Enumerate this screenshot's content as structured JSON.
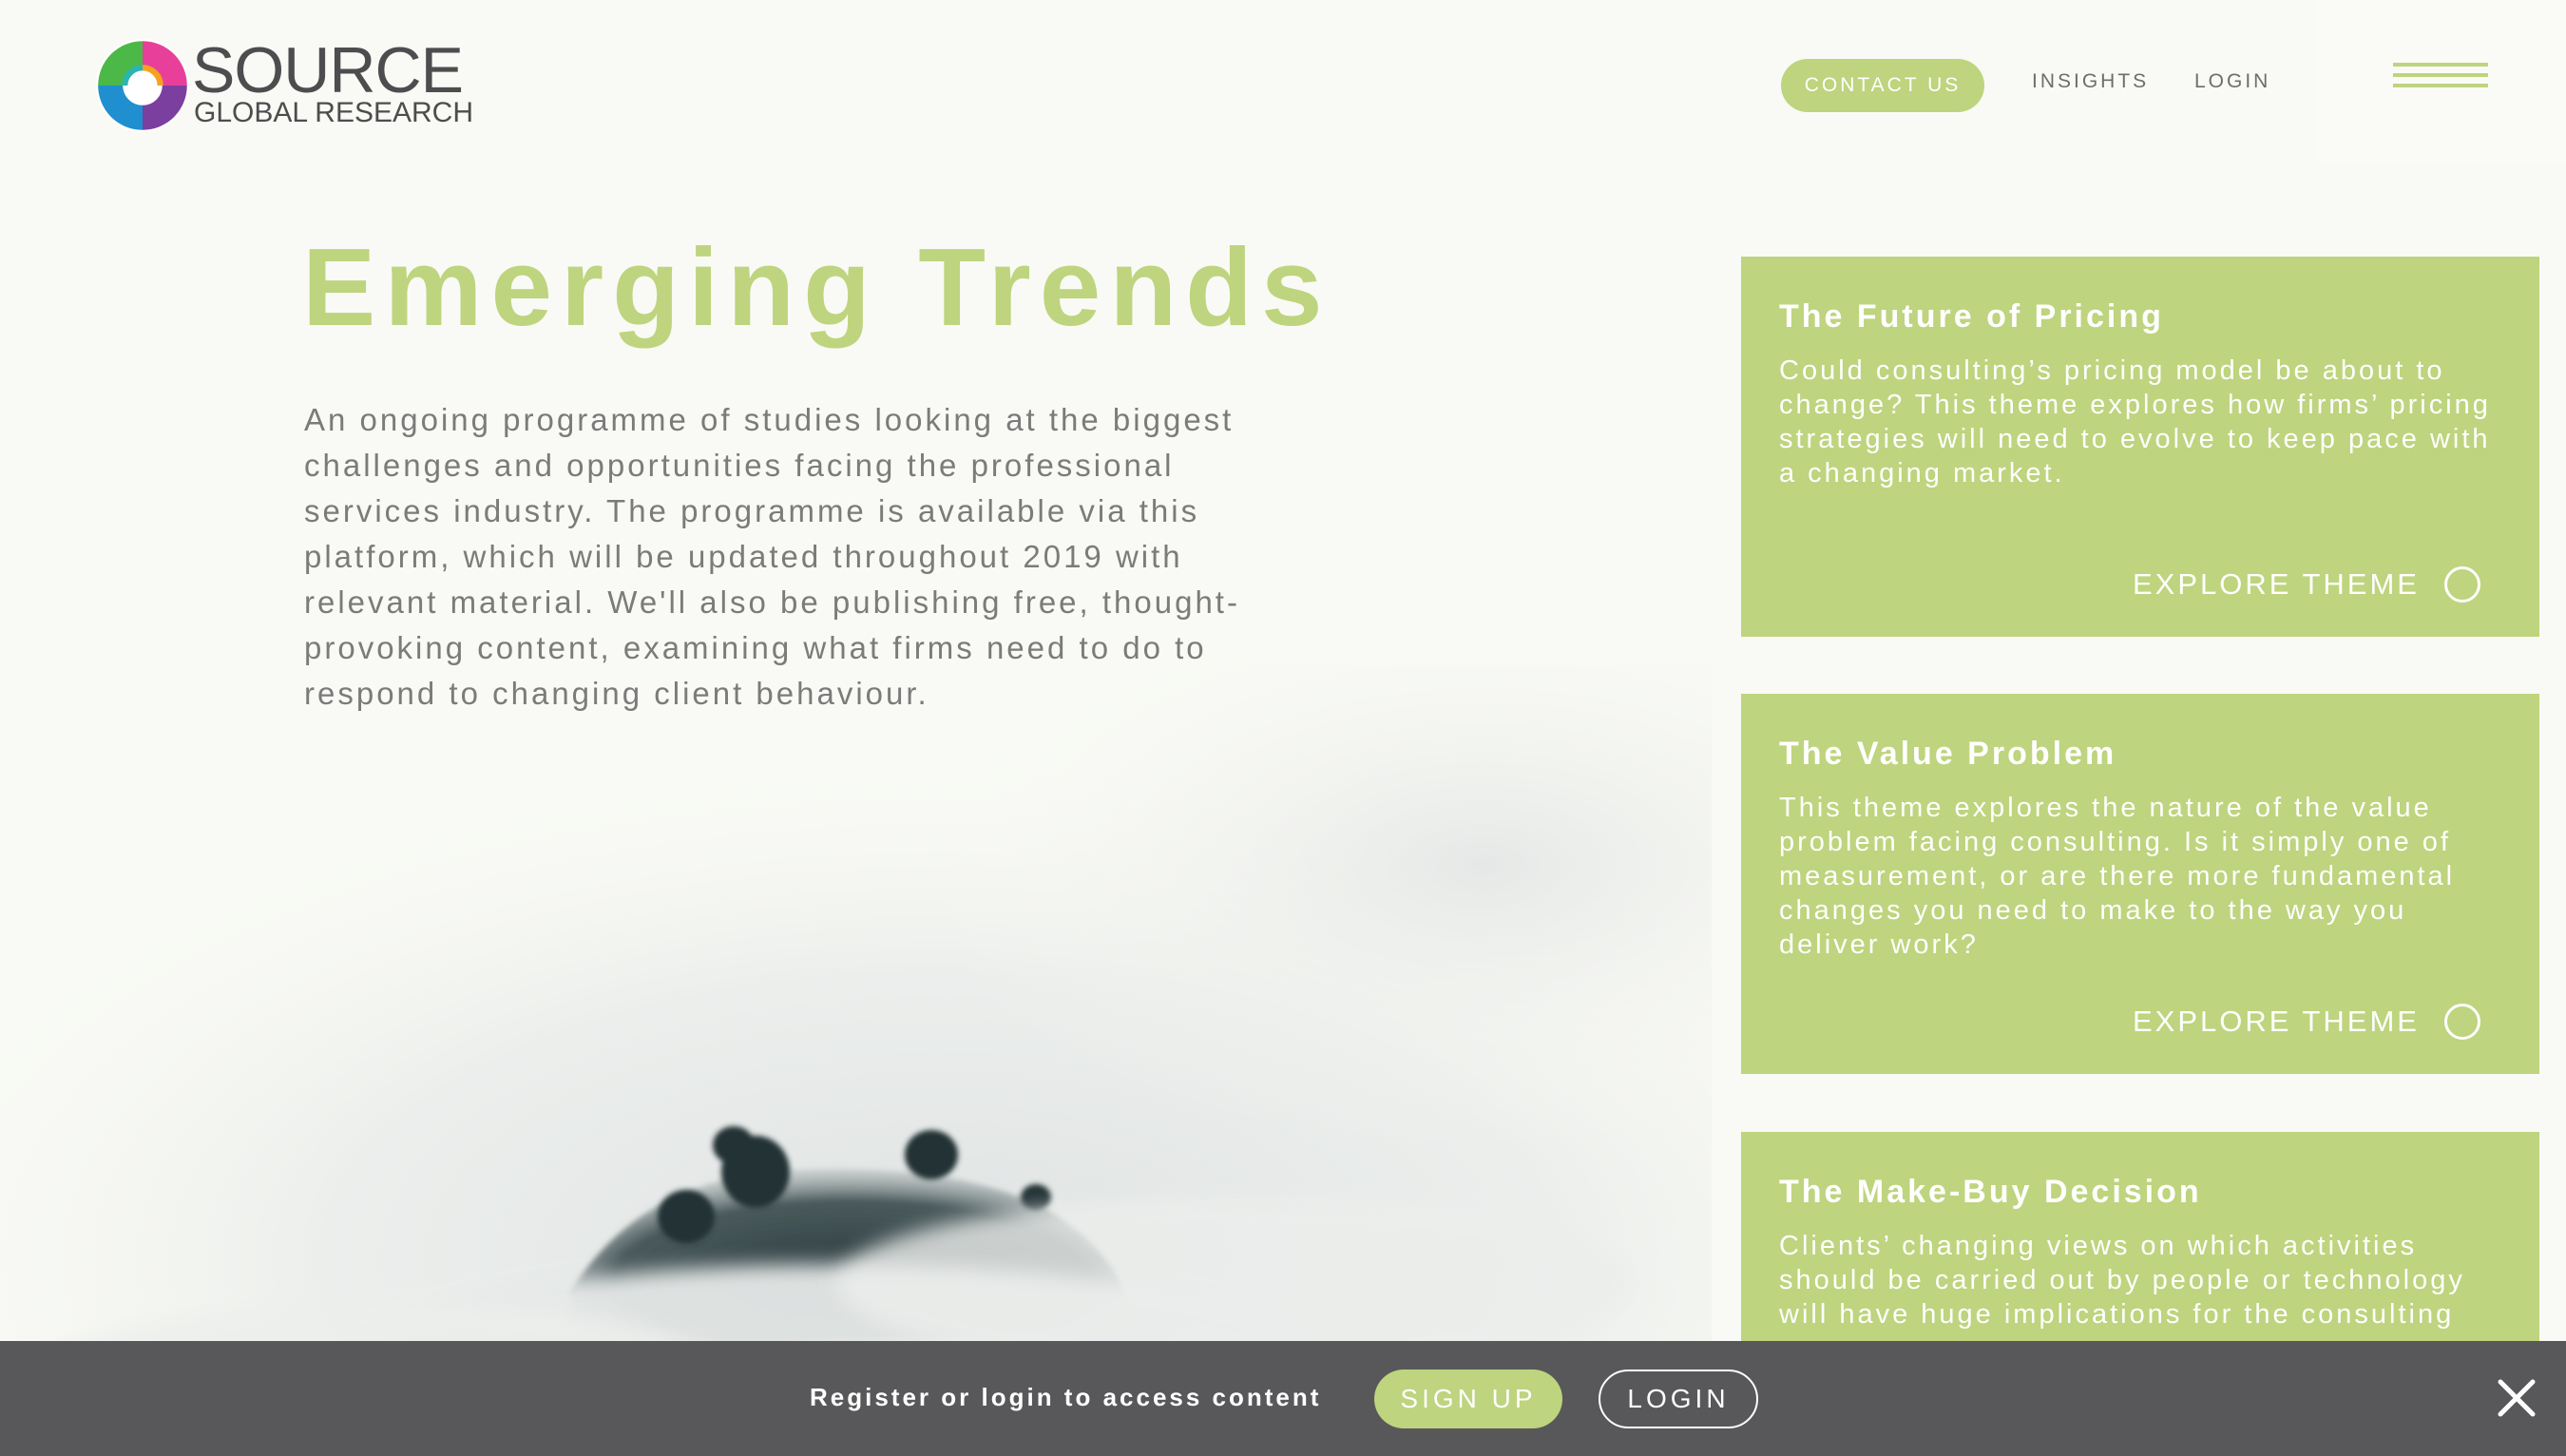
{
  "header": {
    "logo_word": "SOURCE",
    "logo_sub": "GLOBAL RESEARCH",
    "contact_label": "CONTACT US",
    "nav": [
      "INSIGHTS",
      "LOGIN"
    ],
    "menu_icon": "hamburger-menu-icon"
  },
  "hero": {
    "title": "Emerging Trends",
    "intro": "An ongoing programme of studies looking at the biggest challenges and opportunities facing the professional services industry. The programme is available via this platform, which will be updated throughout 2019 with relevant material. We'll also be publishing free, thought-provoking content, examining what firms need to do to respond to changing client behaviour."
  },
  "themes": [
    {
      "title": "The Future of Pricing",
      "description": "Could consulting’s pricing model be about to change? This theme explores how firms’ pricing strategies will need to evolve to keep pace with a changing market.",
      "cta": "EXPLORE THEME"
    },
    {
      "title": "The Value Problem",
      "description": "This theme explores the nature of the value problem facing consulting. Is it simply one of measurement, or are there more fundamental changes you need to make to the way you deliver work?",
      "cta": "EXPLORE THEME"
    },
    {
      "title": "The Make-Buy Decision",
      "description": "Clients’ changing views on which activities should be carried out by people or technology will have huge implications for the consulting"
    }
  ],
  "banner": {
    "text": "Register or login to access content",
    "signup_label": "SIGN UP",
    "login_label": "LOGIN",
    "close_icon": "close-icon"
  },
  "colors": {
    "accent": "#bed47e",
    "background": "#f9faf5",
    "banner": "#58585a",
    "body_text": "#7b7b7b"
  }
}
